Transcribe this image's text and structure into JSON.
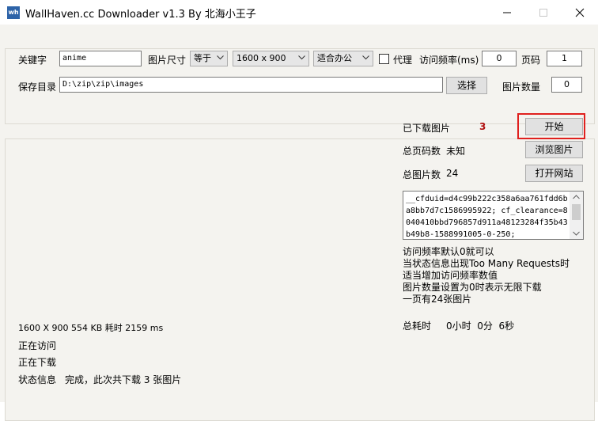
{
  "window": {
    "app_icon_text": "wh",
    "title": "WallHaven.cc Downloader v1.3 By 北海小王子"
  },
  "search": {
    "keyword_label": "关键字",
    "keyword_value": "anime",
    "size_label": "图片尺寸",
    "size_mode": "等于",
    "resolution": "1600 x 900",
    "category": "适合办公",
    "proxy_label": "代理",
    "proxy_checked": false,
    "rate_label": "访问频率(ms)",
    "rate_value": "0",
    "page_label": "页码",
    "page_value": "1",
    "save_label": "保存目录",
    "save_path": "D:\\zip\\zip\\images",
    "choose_button": "选择",
    "count_label": "图片数量",
    "count_value": "0"
  },
  "status": {
    "downloaded_label": "已下载图片",
    "downloaded_count": "3",
    "start_button": "开始",
    "total_pages_label": "总页码数",
    "total_pages_value": "未知",
    "browse_button": "浏览图片",
    "total_images_label": "总图片数",
    "total_images_value": "24",
    "open_site_button": "打开网站",
    "cookie_text": "__cfduid=d4c99b222c358a6aa761fdd6ba8bb7d7c1586995922; cf_clearance=8040410bbd796857d911a48123284f35b43b49b8-1588991005-0-250;",
    "notes": [
      "访问频率默认0就可以",
      "当状态信息出现Too Many Requests时",
      "适当增加访问频率数值",
      "图片数量设置为0时表示无限下载",
      "一页有24张图片"
    ],
    "elapsed_label": "总耗时",
    "elapsed_value": "0小时  0分  6秒",
    "last_image_info": "1600 X 900 554 KB 耗时 2159 ms",
    "visiting_text": "正在访问",
    "downloading_text": "正在下载",
    "state_label": "状态信息",
    "state_value": "完成，此次共下载 3 张图片"
  },
  "colors": {
    "client_bg": "#f4f3ef",
    "highlight": "#e0201e",
    "count_color": "#b01010"
  }
}
